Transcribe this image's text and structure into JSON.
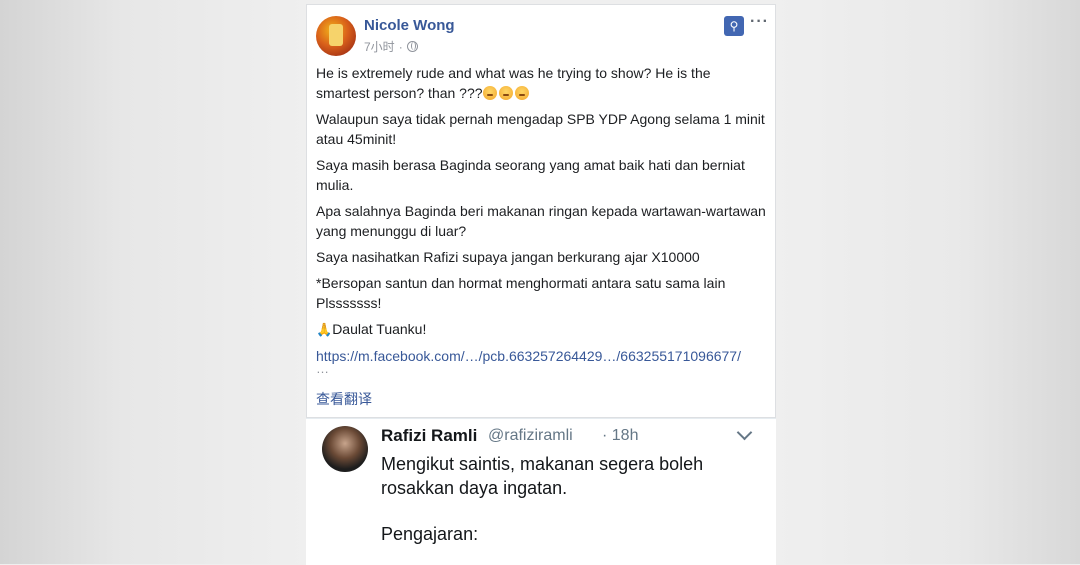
{
  "post": {
    "author": "Nicole Wong",
    "time": "7小时",
    "meta_sep": "·",
    "more": "···",
    "pin_icon": "pushpin-icon",
    "lines": [
      "He is extremely rude and what was he trying to show? He is the smartest person? than ???",
      "Walaupun saya tidak pernah mengadap SPB YDP Agong selama 1 minit atau 45minit!",
      "Saya masih berasa Baginda seorang yang amat baik hati dan berniat mulia.",
      "Apa salahnya Baginda beri makanan ringan kepada wartawan-wartawan yang menunggu di luar?",
      "Saya nasihatkan Rafizi supaya jangan berkurang ajar X10000",
      "*Bersopan santun dan hormat menghormati antara satu sama lain Plsssssss!",
      "Daulat Tuanku!"
    ],
    "link": "https://m.facebook.com/…/pcb.663257264429…/663255171096677/",
    "link_more": "…",
    "translate": "查看翻译",
    "colors": {
      "link": "#385898",
      "pin": "#4267b2"
    }
  },
  "tweet": {
    "name": "Rafizi Ramli",
    "handle": "@rafiziramli",
    "time": "· 18h",
    "line1": "Mengikut saintis, makanan segera boleh rosakkan daya ingatan.",
    "line2": "Pengajaran:"
  }
}
